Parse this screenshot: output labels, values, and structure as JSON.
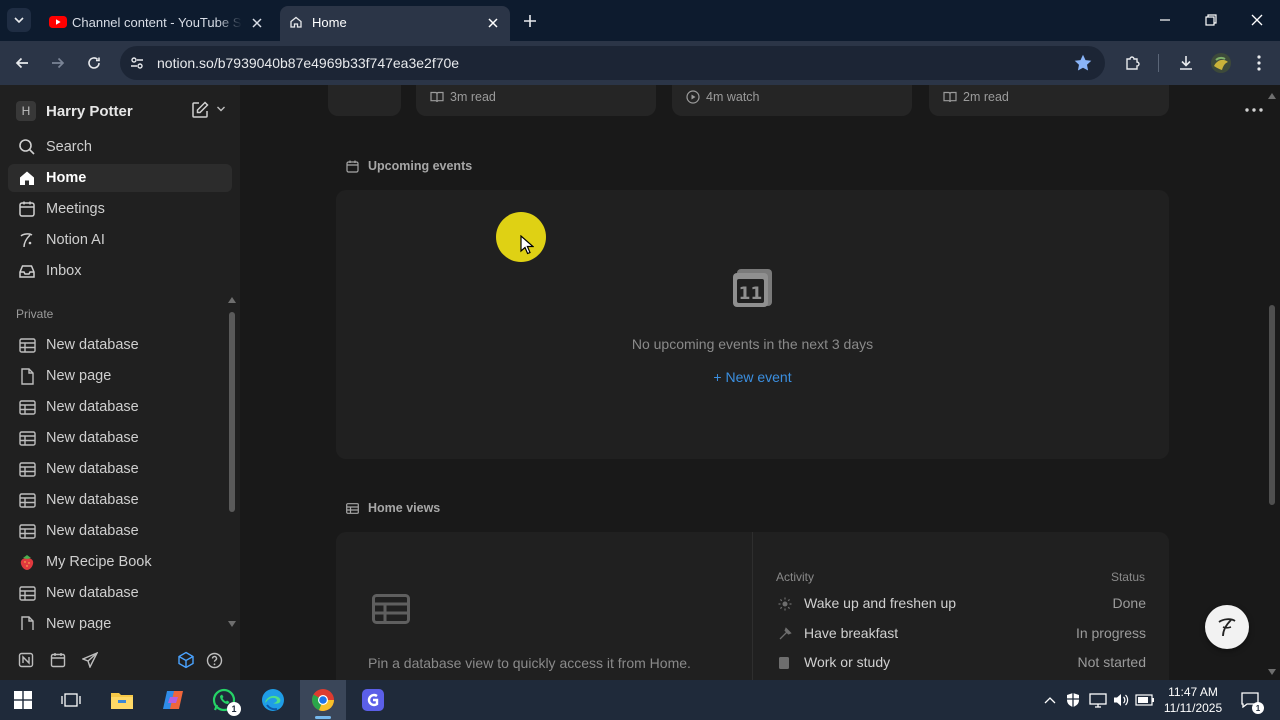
{
  "browser": {
    "tabs": [
      {
        "title": "Channel content - YouTube Studio",
        "active": false,
        "favicon": "youtube-icon"
      },
      {
        "title": "Home",
        "active": true,
        "favicon": "home-icon"
      }
    ],
    "url": "notion.so/b7939040b87e4969b33f747ea3e2f70e"
  },
  "sidebar": {
    "workspace_initial": "H",
    "workspace_name": "Harry Potter",
    "top_items": [
      {
        "label": "Search",
        "icon": "search-icon"
      },
      {
        "label": "Home",
        "icon": "home-icon",
        "active": true
      },
      {
        "label": "Meetings",
        "icon": "meetings-icon"
      },
      {
        "label": "Notion AI",
        "icon": "notion-ai-icon"
      },
      {
        "label": "Inbox",
        "icon": "inbox-icon"
      }
    ],
    "section_label": "Private",
    "private_items": [
      {
        "label": "New database",
        "icon": "table-icon"
      },
      {
        "label": "New page",
        "icon": "page-icon"
      },
      {
        "label": "New database",
        "icon": "table-icon"
      },
      {
        "label": "New database",
        "icon": "table-icon"
      },
      {
        "label": "New database",
        "icon": "table-icon"
      },
      {
        "label": "New database",
        "icon": "table-icon"
      },
      {
        "label": "New database",
        "icon": "table-icon"
      },
      {
        "label": "My Recipe Book",
        "icon": "strawberry-icon"
      },
      {
        "label": "New database",
        "icon": "table-icon"
      },
      {
        "label": "New page",
        "icon": "page-icon"
      }
    ]
  },
  "main": {
    "top_cards": [
      {
        "meta": "3m read",
        "icon": "book-icon"
      },
      {
        "meta": "4m watch",
        "icon": "play-icon"
      },
      {
        "meta": "2m read",
        "icon": "book-icon"
      }
    ],
    "upcoming": {
      "heading": "Upcoming events",
      "calendar_day": "11",
      "empty_text": "No upcoming events in the next 3 days",
      "new_event": "+ New event"
    },
    "home_views": {
      "heading": "Home views",
      "pin_text": "Pin a database view to quickly access it from Home.",
      "col_activity": "Activity",
      "col_status": "Status",
      "rows": [
        {
          "name": "Wake up and freshen up",
          "status": "Done",
          "icon": "sun-icon"
        },
        {
          "name": "Have breakfast",
          "status": "In progress",
          "icon": "fork-icon"
        },
        {
          "name": "Work or study",
          "status": "Not started",
          "icon": "doc-icon"
        }
      ]
    }
  },
  "taskbar": {
    "time": "11:47 AM",
    "date": "11/11/2025",
    "whatsapp_badge": "1",
    "notification_badge": "1"
  },
  "colors": {
    "accent_link": "#3b8fe0",
    "cursor_highlight": "#f0e114",
    "sidebar_bg": "#202020",
    "main_bg": "#191919"
  }
}
